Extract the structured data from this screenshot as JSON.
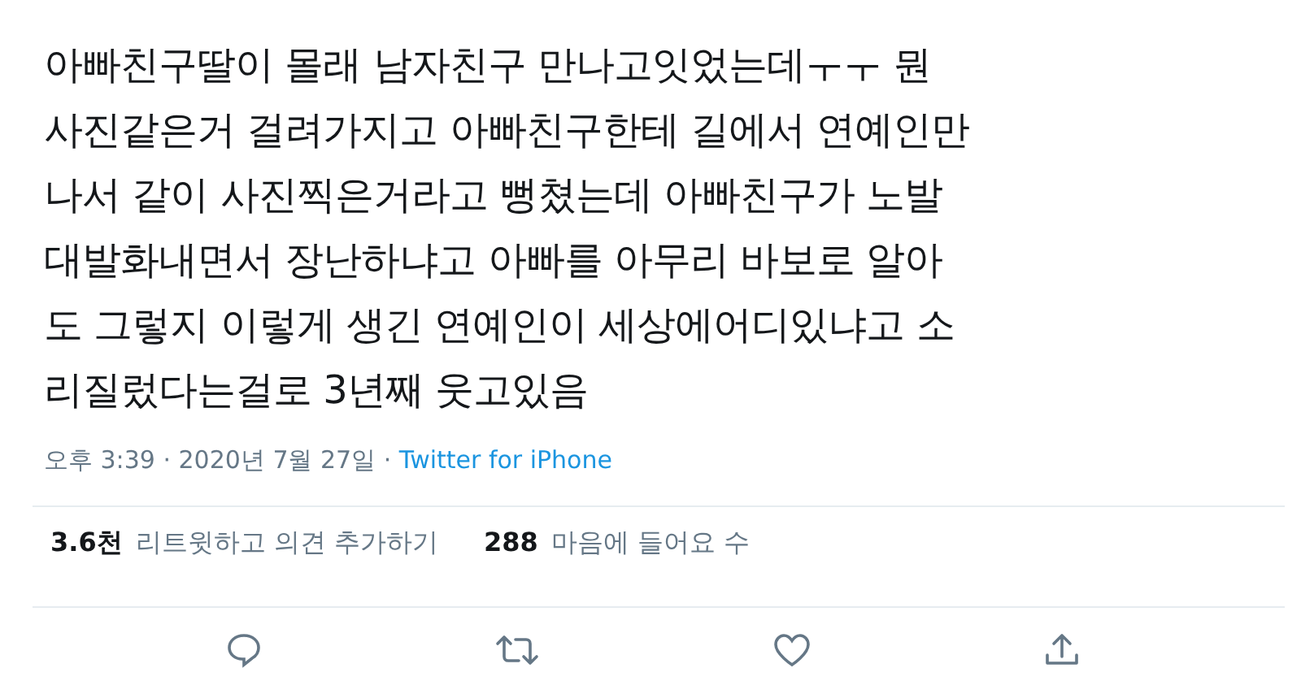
{
  "tweet": {
    "text_lines": [
      "아빠친구딸이 몰래 남자친구 만나고잇었는데ㅜㅜ 뭔",
      "사진같은거 걸려가지고 아빠친구한테 길에서 연예인만",
      "나서 같이 사진찍은거라고 뻥쳤는데 아빠친구가 노발",
      "대발화내면서 장난하냐고 아빠를 아무리 바보로 알아",
      "도 그렇지 이렇게 생긴 연예인이 세상에어디있냐고 소",
      "리질렀다는걸로 3년째 웃고있음"
    ],
    "timestamp": "오후 3:39 · 2020년 7월 27일 · ",
    "source": "Twitter for iPhone",
    "stats": [
      {
        "count": "3.6천",
        "label": "리트윗하고 의견 추가하기"
      },
      {
        "count": "288",
        "label": "마음에 들어요 수"
      }
    ],
    "actions": [
      {
        "kind": "reply"
      },
      {
        "kind": "retweet"
      },
      {
        "kind": "like"
      },
      {
        "kind": "share"
      }
    ]
  }
}
